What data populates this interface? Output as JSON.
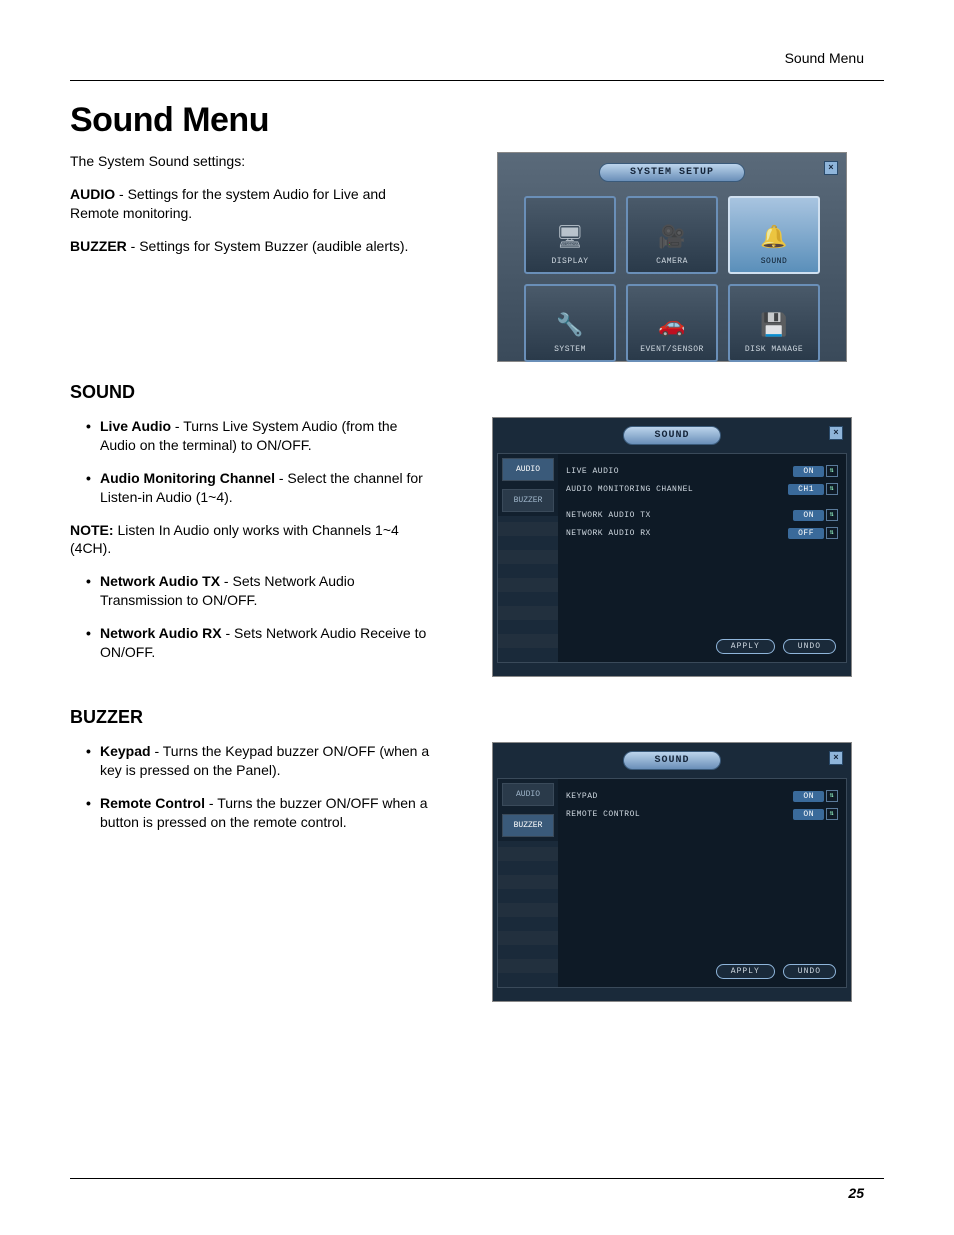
{
  "header_label": "Sound Menu",
  "page_title": "Sound Menu",
  "intro": "The System Sound settings:",
  "audio_def_b": "AUDIO",
  "audio_def": " - Settings for the system Audio for Live and Remote monitoring.",
  "buzzer_def_b": "BUZZER",
  "buzzer_def": " - Settings for System Buzzer (audible alerts).",
  "setup": {
    "title": "SYSTEM SETUP",
    "tiles": [
      "DISPLAY",
      "CAMERA",
      "SOUND",
      "SYSTEM",
      "EVENT/SENSOR",
      "DISK MANAGE"
    ],
    "active_index": 2
  },
  "sound_h": "SOUND",
  "sound_bullets": [
    {
      "b": "Live Audio",
      "t": " - Turns Live System Audio (from the Audio on the terminal) to ON/OFF."
    },
    {
      "b": "Audio Monitoring Channel",
      "t": " - Select the channel for Listen-in Audio (1~4)."
    }
  ],
  "note_b": "NOTE:",
  "note_t": " Listen In Audio only works with Channels 1~4 (4CH).",
  "sound_bullets2": [
    {
      "b": "Network Audio TX",
      "t": " - Sets Network Audio Transmission to ON/OFF."
    },
    {
      "b": "Network Audio RX",
      "t": " - Sets Network Audio Receive to ON/OFF."
    }
  ],
  "sound_panel": {
    "title": "SOUND",
    "tabs": [
      "AUDIO",
      "BUZZER"
    ],
    "active_tab": 0,
    "rows": [
      {
        "label": "LIVE AUDIO",
        "value": "ON"
      },
      {
        "label": "AUDIO MONITORING CHANNEL",
        "value": "CH1"
      },
      {
        "label": "NETWORK AUDIO TX",
        "value": "ON"
      },
      {
        "label": "NETWORK AUDIO RX",
        "value": "OFF"
      }
    ],
    "apply": "APPLY",
    "undo": "UNDO"
  },
  "buzzer_h": "BUZZER",
  "buzzer_bullets": [
    {
      "b": "Keypad",
      "t": " - Turns the Keypad buzzer ON/OFF (when a key is pressed on the Panel)."
    },
    {
      "b": "Remote Control",
      "t": " - Turns the buzzer ON/OFF when a button is pressed on the remote control."
    }
  ],
  "buzzer_panel": {
    "title": "SOUND",
    "tabs": [
      "AUDIO",
      "BUZZER"
    ],
    "active_tab": 1,
    "rows": [
      {
        "label": "KEYPAD",
        "value": "ON"
      },
      {
        "label": "REMOTE CONTROL",
        "value": "ON"
      }
    ],
    "apply": "APPLY",
    "undo": "UNDO"
  },
  "page_number": "25"
}
